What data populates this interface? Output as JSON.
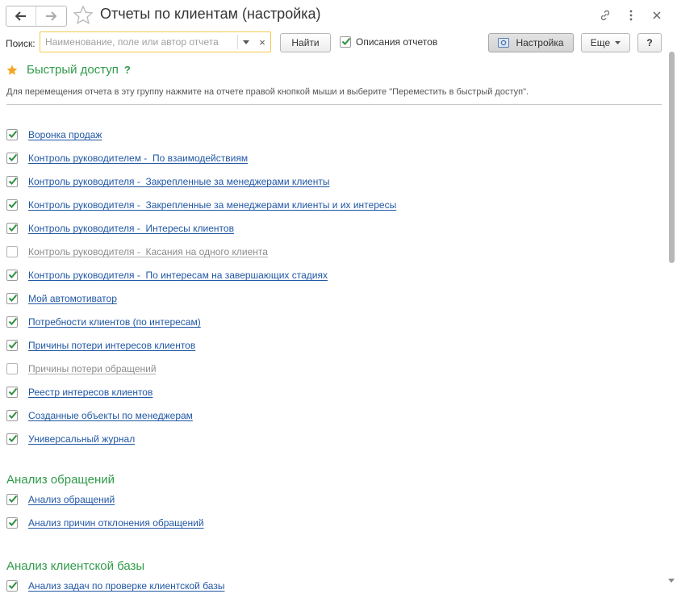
{
  "window": {
    "title": "Отчеты по клиентам (настройка)"
  },
  "toolbar": {
    "search_label": "Поиск:",
    "search_placeholder": "Наименование, поле или автор отчета",
    "clear_symbol": "×",
    "find_label": "Найти",
    "descriptions_label": "Описания отчетов",
    "descriptions_checked": true,
    "setup_label": "Настройка",
    "more_label": "Еще",
    "help_label": "?"
  },
  "quick_access": {
    "title": "Быстрый доступ",
    "help": "?",
    "hint": "Для перемещения отчета в эту группу нажмите на отчете правой кнопкой мыши и выберите \"Переместить в быстрый доступ\".",
    "items": [
      {
        "label": "Воронка продаж",
        "checked": true
      },
      {
        "label": "Контроль руководителем -  По взаимодействиям",
        "checked": true
      },
      {
        "label": "Контроль руководителя -  Закрепленные за менеджерами клиенты",
        "checked": true
      },
      {
        "label": "Контроль руководителя -  Закрепленные за менеджерами клиенты и их интересы",
        "checked": true
      },
      {
        "label": "Контроль руководителя -  Интересы клиентов",
        "checked": true
      },
      {
        "label": "Контроль руководителя -  Касания на одного клиента",
        "checked": false
      },
      {
        "label": "Контроль руководителя -  По интересам на завершающих стадиях",
        "checked": true
      },
      {
        "label": "Мой автомотиватор",
        "checked": true
      },
      {
        "label": "Потребности клиентов (по интересам)",
        "checked": true
      },
      {
        "label": "Причины потери интересов клиентов",
        "checked": true
      },
      {
        "label": "Причины потери обращений",
        "checked": false
      },
      {
        "label": "Реестр интересов клиентов",
        "checked": true
      },
      {
        "label": "Созданные объекты по менеджерам",
        "checked": true
      },
      {
        "label": "Универсальный журнал",
        "checked": true
      }
    ]
  },
  "groups": [
    {
      "title": "Анализ обращений",
      "items": [
        {
          "label": "Анализ обращений",
          "checked": true
        },
        {
          "label": "Анализ причин отклонения обращений",
          "checked": true
        }
      ]
    },
    {
      "title": "Анализ клиентской базы",
      "items": [
        {
          "label": "Анализ задач по проверке клиентской базы",
          "checked": true
        }
      ]
    }
  ],
  "colors": {
    "accent_green": "#2f9b4a",
    "link_blue": "#2157a4",
    "search_border": "#f2c94c",
    "star_orange": "#f5a623"
  },
  "icons": {
    "back": "arrow-left-icon",
    "forward": "arrow-right-icon",
    "favorite": "star-outline-icon",
    "link": "link-icon",
    "menu": "vertical-dots-icon",
    "close": "close-icon",
    "setup": "settings-panel-icon",
    "quick_access_star": "star-filled-icon"
  }
}
